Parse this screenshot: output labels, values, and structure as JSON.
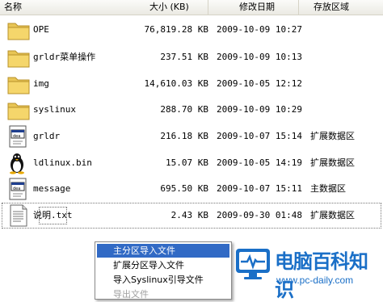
{
  "header": {
    "name": "名称",
    "size": "大小 (KB)",
    "modified": "修改日期",
    "storage": "存放区域"
  },
  "files": [
    {
      "name": "OPE",
      "size": "76,819.28 KB",
      "date": "2009-10-09 10:27",
      "store": "",
      "icon": "folder-icon"
    },
    {
      "name": "grldr菜单操作",
      "size": "237.51 KB",
      "date": "2009-10-09 10:13",
      "store": "",
      "icon": "folder-icon"
    },
    {
      "name": "img",
      "size": "14,610.03 KB",
      "date": "2009-10-05 12:12",
      "store": "",
      "icon": "folder-icon"
    },
    {
      "name": "syslinux",
      "size": "288.70 KB",
      "date": "2009-10-09 10:29",
      "store": "",
      "icon": "folder-icon"
    },
    {
      "name": "grldr",
      "size": "216.18 KB",
      "date": "2009-10-07 15:14",
      "store": "扩展数据区",
      "icon": "system-file-icon"
    },
    {
      "name": "ldlinux.bin",
      "size": "15.07 KB",
      "date": "2009-10-05 14:19",
      "store": "扩展数据区",
      "icon": "linux-penguin-icon"
    },
    {
      "name": "message",
      "size": "695.50 KB",
      "date": "2009-10-07 15:11",
      "store": "主数据区",
      "icon": "system-file-icon"
    },
    {
      "name": "说明.txt",
      "size": "2.43 KB",
      "date": "2009-09-30 01:48",
      "store": "扩展数据区",
      "icon": "text-file-icon"
    }
  ],
  "context_menu": {
    "items": [
      {
        "label": "主分区导入文件"
      },
      {
        "label": "扩展分区导入文件"
      },
      {
        "label": "导入Syslinux引导文件"
      },
      {
        "label": "导出文件"
      }
    ]
  },
  "watermark": {
    "title": "电脑百科知识",
    "url": "www.pc-daily.com"
  },
  "colors": {
    "menu_highlight": "#316ac5",
    "folder": "#e8c555",
    "watermark": "#1a6fc7"
  }
}
